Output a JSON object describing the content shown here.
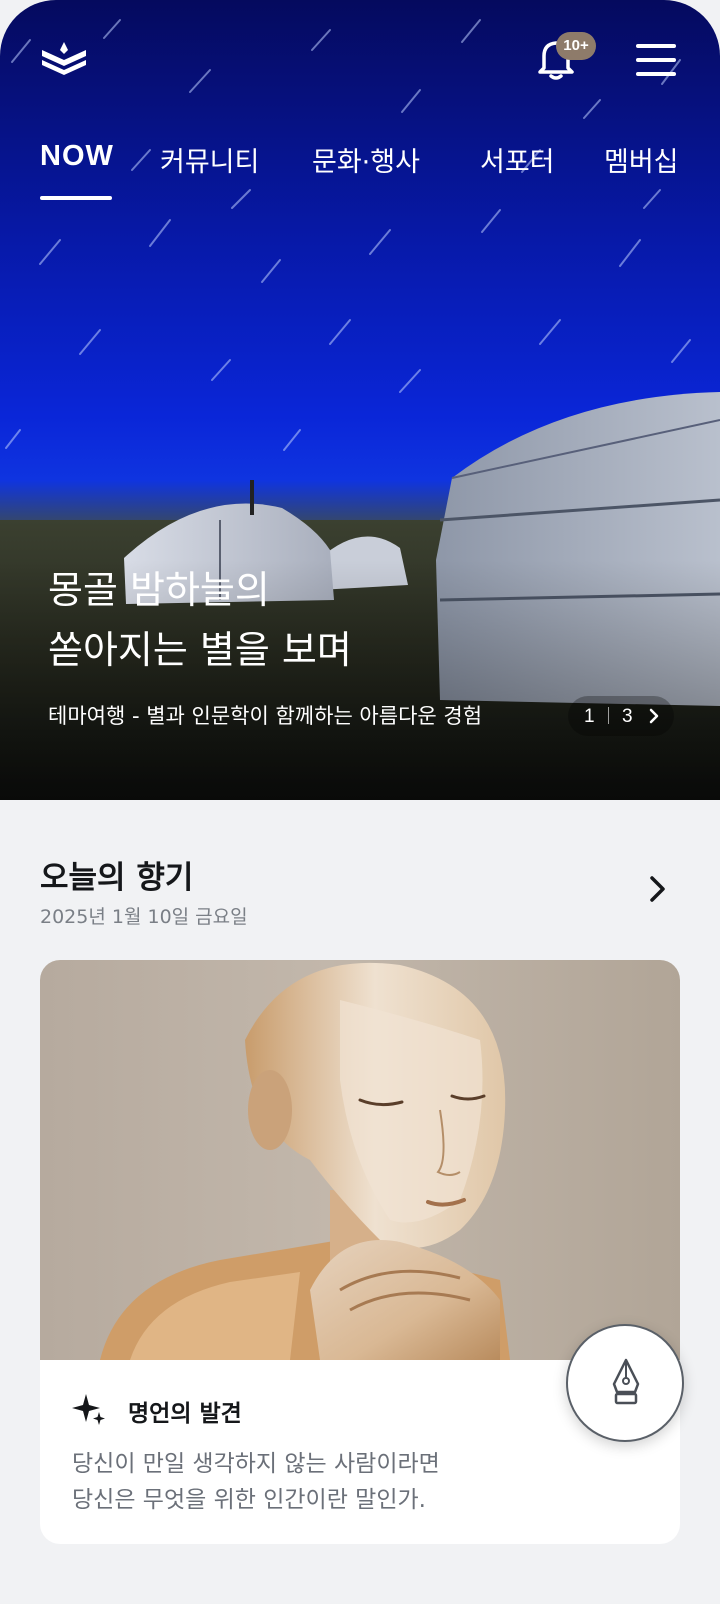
{
  "header": {
    "logo_icon": "layered-chevron-logo",
    "notification_badge": "10+",
    "bell_icon": "bell-icon",
    "menu_icon": "hamburger-menu-icon"
  },
  "tabs": [
    {
      "label": "NOW",
      "active": true
    },
    {
      "label": "커뮤니티",
      "active": false
    },
    {
      "label": "문화·행사",
      "active": false
    },
    {
      "label": "서포터",
      "active": false
    },
    {
      "label": "멤버십",
      "active": false
    }
  ],
  "hero": {
    "title_line1": "몽골 밤하늘의",
    "title_line2": "쏟아지는 별을 보며",
    "subtitle": "테마여행 - 별과 인문학이 함께하는 아름다운 경험",
    "pager_current": "1",
    "pager_total": "3"
  },
  "section": {
    "title": "오늘의 향기",
    "date": "2025년 1월 10일 금요일"
  },
  "quote_card": {
    "label": "명언의 발견",
    "line1": "당신이 만일 생각하지 않는 사람이라면",
    "line2": "당신은 무엇을 위한 인간이란 말인가."
  },
  "fab": {
    "icon": "fountain-pen-icon"
  },
  "colors": {
    "hero_sky": "#0a26d8",
    "badge": "#8e7b6a",
    "page_bg": "#f1f2f4",
    "text_dark": "#15171a",
    "text_muted": "#6b7079"
  }
}
